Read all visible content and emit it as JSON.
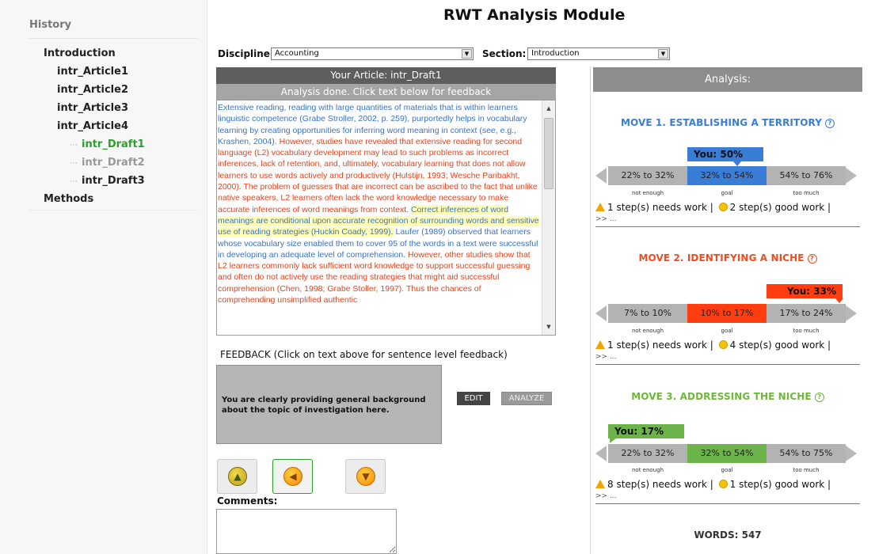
{
  "page_title": "RWT Analysis Module",
  "sidebar": {
    "title": "History",
    "items": [
      {
        "label": "Introduction",
        "level": 0,
        "state": "normal"
      },
      {
        "label": "intr_Article1",
        "level": 1,
        "state": "normal"
      },
      {
        "label": "intr_Article2",
        "level": 1,
        "state": "normal"
      },
      {
        "label": "intr_Article3",
        "level": 1,
        "state": "normal"
      },
      {
        "label": "intr_Article4",
        "level": 1,
        "state": "normal"
      },
      {
        "label": "intr_Draft1",
        "level": 2,
        "state": "active"
      },
      {
        "label": "intr_Draft2",
        "level": 2,
        "state": "muted"
      },
      {
        "label": "intr_Draft3",
        "level": 2,
        "state": "normal"
      },
      {
        "label": "Methods",
        "level": 0,
        "state": "normal"
      }
    ]
  },
  "filters": {
    "discipline_label": "Discipline:",
    "discipline_value": "Accounting",
    "section_label": "Section:",
    "section_value": "Introduction"
  },
  "article": {
    "header": "Your Article: intr_Draft1",
    "subheader": "Analysis done. Click text below for feedback",
    "sentences": [
      {
        "text": "Extensive reading, reading with large quantities of materials that is within learners linguistic competence (Grabe Stroller, 2002, p. 259), purportedly helps in vocabulary learning by creating opportunities for inferring word meaning in context (see, e.g., Krashen, 2004).",
        "color": "blue"
      },
      {
        "text": "However, studies have revealed that extensive reading for second language (L2) vocabulary development may lead to such problems as incorrect inferences, lack of retention, and, ultimately, vocabulary learning that does not allow learners to use words actively and productively (Hulstijn, 1993; Wesche Paribakht, 2000).",
        "color": "red"
      },
      {
        "text": "The problem of guesses that are incorrect can be ascribed to the fact that unlike native speakers, L2 learners often lack the word knowledge necessary to make accurate inferences of word meanings from context.",
        "color": "red"
      },
      {
        "text": "Correct inferences of word meanings are conditional upon accurate recognition of surrounding words and sensitive use of reading strategies (Huckin Coady, 1999).",
        "color": "highlight"
      },
      {
        "text": "Laufer (1989) observed that learners whose vocabulary size enabled them to cover 95 of the words in a text were successful in developing an adequate level of comprehension.",
        "color": "blue"
      },
      {
        "text": "However, other studies show that L2 learners commonly lack sufficient word knowledge to support successful guessing and often do not actively use the reading strategies that might aid successful comprehension (Chen, 1998; Grabe Stoller, 1997).",
        "color": "red"
      },
      {
        "text": "Thus the chances of comprehending unsimplified authentic",
        "color": "red"
      }
    ]
  },
  "feedback": {
    "label": "FEEDBACK (Click on text above for sentence level feedback)",
    "text": "You are clearly providing general background about the topic of investigation here.",
    "edit_label": "EDIT",
    "analyze_label": "ANALYZE"
  },
  "rating": {
    "options": [
      "thumbs-up",
      "thumbs-neutral",
      "thumbs-down"
    ],
    "selected": "thumbs-neutral"
  },
  "comments": {
    "label": "Comments:",
    "value": ""
  },
  "analysis": {
    "header": "Analysis:",
    "moves": [
      {
        "title": "MOVE 1. ESTABLISHING A TERRITORY",
        "color": "#3a7dd6",
        "you_label": "You: 50%",
        "you_value_pct": 50,
        "ranges": [
          "22% to 32%",
          "32% to 54%",
          "54% to 76%"
        ],
        "range_labels": [
          "not enough",
          "goal",
          "too much"
        ],
        "highlight_index": 1,
        "highlight_color": "#3a7dd6",
        "warn_text": "1 step(s) needs work |",
        "good_text": "2 step(s) good work |",
        "more_text": ">> ..."
      },
      {
        "title": "MOVE 2. IDENTIFYING A NICHE",
        "color": "#f04a1d",
        "you_label": "You: 33%",
        "you_value_pct": 33,
        "ranges": [
          "7% to 10%",
          "10% to 17%",
          "17% to 24%"
        ],
        "range_labels": [
          "not enough",
          "goal",
          "too much"
        ],
        "highlight_index": 1,
        "highlight_color": "#ff3d10",
        "warn_text": "1 step(s) needs work |",
        "good_text": "4 step(s) good work |",
        "more_text": ">> ..."
      },
      {
        "title": "MOVE 3. ADDRESSING THE NICHE",
        "color": "#6eb63c",
        "you_label": "You: 17%",
        "you_value_pct": 17,
        "ranges": [
          "22% to 32%",
          "32% to 54%",
          "54% to 75%"
        ],
        "range_labels": [
          "not enough",
          "goal",
          "too much"
        ],
        "highlight_index": 1,
        "highlight_color": "#6cb44a",
        "warn_text": "8 step(s) needs work |",
        "good_text": "1 step(s) good work |",
        "more_text": ">> ..."
      }
    ],
    "words_label": "WORDS: 547"
  }
}
